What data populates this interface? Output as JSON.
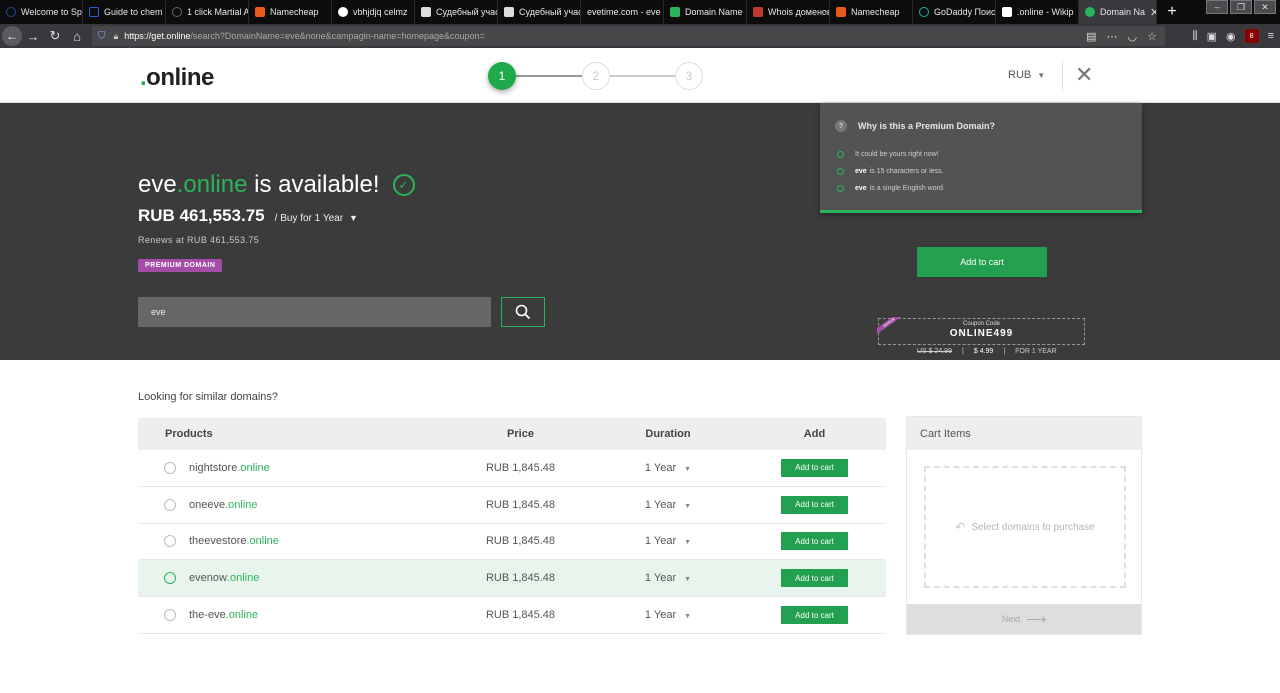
{
  "browser": {
    "tabs": [
      {
        "title": "Welcome to Sp",
        "color": "#1b4c9a",
        "active": false
      },
      {
        "title": "Guide to chem",
        "color": "#2c5fd1",
        "active": false
      },
      {
        "title": "1 click Martial A",
        "color": "#444444",
        "active": false
      },
      {
        "title": "Namecheap",
        "color": "#e8591a",
        "active": false
      },
      {
        "title": "vbhjdjq celmz",
        "color": "#ffffff",
        "active": false
      },
      {
        "title": "Судебный учас",
        "color": "#dddddd",
        "active": false
      },
      {
        "title": "Судебный учас",
        "color": "#dddddd",
        "active": false
      },
      {
        "title": "evetime.com - eve",
        "color": "#0c0c0d",
        "active": false
      },
      {
        "title": "Domain Name",
        "color": "#2ab45a",
        "active": false
      },
      {
        "title": "Whois доменов",
        "color": "#c0392b",
        "active": false
      },
      {
        "title": "Namecheap",
        "color": "#e8591a",
        "active": false
      },
      {
        "title": "GoDaddy Поис",
        "color": "#1bb2a8",
        "active": false
      },
      {
        "title": ".online - Wikip",
        "color": "#ffffff",
        "active": false
      },
      {
        "title": "Domain Na",
        "color": "#2ab45a",
        "active": true
      }
    ],
    "url_host": "https://get.online",
    "url_path": "/search?DomainName=eve&none&campagin-name=homepage&coupon=",
    "ublock_count": "8"
  },
  "header": {
    "logo_dot": ".",
    "logo_text": "online",
    "steps": [
      "1",
      "2",
      "3"
    ],
    "currency": "RUB"
  },
  "hero": {
    "domain_name": "eve",
    "domain_tld": ".online",
    "available_text": " is available!",
    "price": "RUB 461,553.75",
    "buy_term": "/ Buy for 1 Year",
    "renews": "Renews at RUB 461,553.75",
    "badge": "PREMIUM DOMAIN",
    "search_value": "eve",
    "why_title": "Why is this a Premium Domain?",
    "why_items": [
      {
        "bold": "",
        "text": "It could be yours right now!"
      },
      {
        "bold": "eve",
        "text": "is 15 characters or less."
      },
      {
        "bold": "eve",
        "text": "is a single English word."
      }
    ],
    "add_to_cart": "Add to cart",
    "coupon_label": "Coupon Code",
    "coupon_code": "ONLINE499",
    "coupon_ribbon": "OFFER",
    "coupon_old_price": "US $ 24.99",
    "coupon_new_price": "$ 4.99",
    "coupon_term": "FOR 1 YEAR"
  },
  "similar": {
    "title": "Looking for similar domains?",
    "columns": [
      "Products",
      "Price",
      "Duration",
      "Add"
    ],
    "rows": [
      {
        "name": "nightstore",
        "tld": ".online",
        "price": "RUB 1,845.48",
        "duration": "1 Year",
        "button": "Add to cart"
      },
      {
        "name": "oneeve",
        "tld": ".online",
        "price": "RUB 1,845.48",
        "duration": "1 Year",
        "button": "Add to cart"
      },
      {
        "name": "theevestore",
        "tld": ".online",
        "price": "RUB 1,845.48",
        "duration": "1 Year",
        "button": "Add to cart"
      },
      {
        "name": "evenow",
        "tld": ".online",
        "price": "RUB 1,845.48",
        "duration": "1 Year",
        "button": "Add to cart"
      },
      {
        "name": "the-eve",
        "tld": ".online",
        "price": "RUB 1,845.48",
        "duration": "1 Year",
        "button": "Add to cart"
      }
    ]
  },
  "cart": {
    "title": "Cart Items",
    "empty_text": "Select domains to purchase",
    "next": "Next"
  },
  "colors": {
    "brand_green": "#2ab45a",
    "hero_bg": "#3b3b3b",
    "premium_purple": "#a34ca8"
  }
}
